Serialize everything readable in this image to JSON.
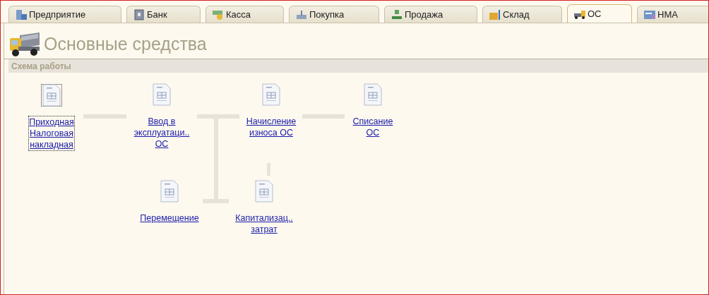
{
  "tabs": [
    {
      "label": "Предприятие",
      "selected": false
    },
    {
      "label": "Банк",
      "selected": false
    },
    {
      "label": "Касса",
      "selected": false
    },
    {
      "label": "Покупка",
      "selected": false
    },
    {
      "label": "Продажа",
      "selected": false
    },
    {
      "label": "Склад",
      "selected": false
    },
    {
      "label": "ОС",
      "selected": true
    },
    {
      "label": "НМА",
      "selected": false
    }
  ],
  "page_title": "Основные средства",
  "section": {
    "title": "Схема работы"
  },
  "diagram": {
    "nodes": [
      {
        "label": "Приходная\nНалоговая\nнакладная",
        "selected": true
      },
      {
        "label": "Ввод в\nэксплуатаци..\nОС",
        "selected": false
      },
      {
        "label": "Начисление\nизноса ОС",
        "selected": false
      },
      {
        "label": "Списание\nОС",
        "selected": false
      },
      {
        "label": "Перемещение",
        "selected": false
      },
      {
        "label": "Капитализац..\nзатрат",
        "selected": false
      }
    ]
  }
}
